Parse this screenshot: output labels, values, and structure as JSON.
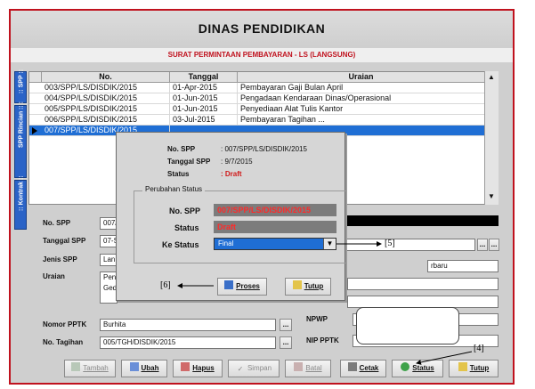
{
  "window": {
    "title": "DINAS PENDIDIKAN",
    "subtitle": "SURAT PERMINTAAN PEMBAYARAN - LS (LANGSUNG)"
  },
  "side_tabs": [
    ":: SPP ::",
    "SPP Rincian :: :",
    ":: Kontrak ::"
  ],
  "grid": {
    "headers": [
      "No.",
      "Tanggal",
      "Uraian"
    ],
    "rows": [
      {
        "no": "003/SPP/LS/DISDIK/2015",
        "tanggal": "01-Apr-2015",
        "uraian": "Pembayaran Gaji Bulan April"
      },
      {
        "no": "004/SPP/LS/DISDIK/2015",
        "tanggal": "01-Jun-2015",
        "uraian": "Pengadaan Kendaraan Dinas/Operasional"
      },
      {
        "no": "005/SPP/LS/DISDIK/2015",
        "tanggal": "01-Jun-2015",
        "uraian": "Penyediaan Alat Tulis Kantor"
      },
      {
        "no": "006/SPP/LS/DISDIK/2015",
        "tanggal": "03-Jul-2015",
        "uraian": "Pembayaran Tagihan ..."
      },
      {
        "no": "007/SPP/LS/DISDIK/2015",
        "tanggal": "",
        "uraian": ""
      }
    ]
  },
  "form": {
    "no_spp_label": "No. SPP",
    "no_spp_value": "007/",
    "tanggal_label": "Tanggal SPP",
    "tanggal_value": "07-S",
    "jenis_label": "Jenis SPP",
    "jenis_value": "Lan",
    "uraian_label": "Uraian",
    "uraian_value": "Pen\nGed",
    "nomor_pptk_label": "Nomor PPTK",
    "nomor_pptk_value": "Burhita",
    "no_tagihan_label": "No. Tagihan",
    "no_tagihan_value": "005/TGH/DISDIK/2015",
    "npwp_label": "NPWP",
    "nip_pptk_label": "NIP PPTK",
    "right_value": "rbaru",
    "ellipsis": "..."
  },
  "toolbar": {
    "tambah": "Tambah",
    "ubah": "Ubah",
    "hapus": "Hapus",
    "simpan": "Simpan",
    "batal": "Batal",
    "cetak": "Cetak",
    "status": "Status",
    "tutup": "Tutup"
  },
  "dialog": {
    "no_spp_label": "No. SPP",
    "no_spp_value": ": 007/SPP/LS/DISDIK/2015",
    "tanggal_label": "Tanggal SPP",
    "tanggal_value": ": 9/7/2015",
    "status_label": "Status",
    "status_value": ": Draft",
    "group_title": "Perubahan Status",
    "g_no_spp_label": "No. SPP",
    "g_no_spp_value": "007/SPP/LS/DISDIK/2015",
    "g_status_label": "Status",
    "g_status_value": "Draft",
    "ke_status_label": "Ke Status",
    "ke_status_value": "Final",
    "proses": "Proses",
    "tutup": "Tutup"
  },
  "callouts": {
    "c4": "[4]",
    "c5": "[5]",
    "c6": "[6]"
  },
  "colors": {
    "accent": "#c0121e",
    "selection": "#1f6ed4",
    "tab": "#2a63c7"
  }
}
